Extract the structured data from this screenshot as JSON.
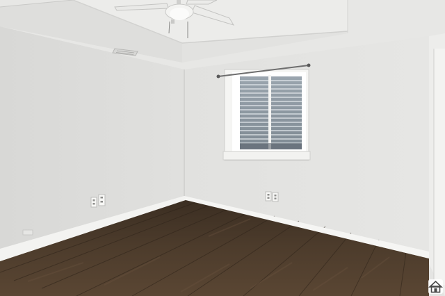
{
  "scene": {
    "subject": "empty-room-interior",
    "colors": {
      "ceiling": "#e9e9e7",
      "left_wall": "#dcdcda",
      "back_wall": "#e4e4e2",
      "right_wall": "#e8e8e6",
      "floor": "#4a3a2b",
      "baseboard": "#f4f4f2",
      "window_frame": "#f5f5f3",
      "shutter": "#8c97a1"
    },
    "icons": {
      "fan": "ceiling-fan-icon",
      "watermark": "house-icon"
    }
  }
}
